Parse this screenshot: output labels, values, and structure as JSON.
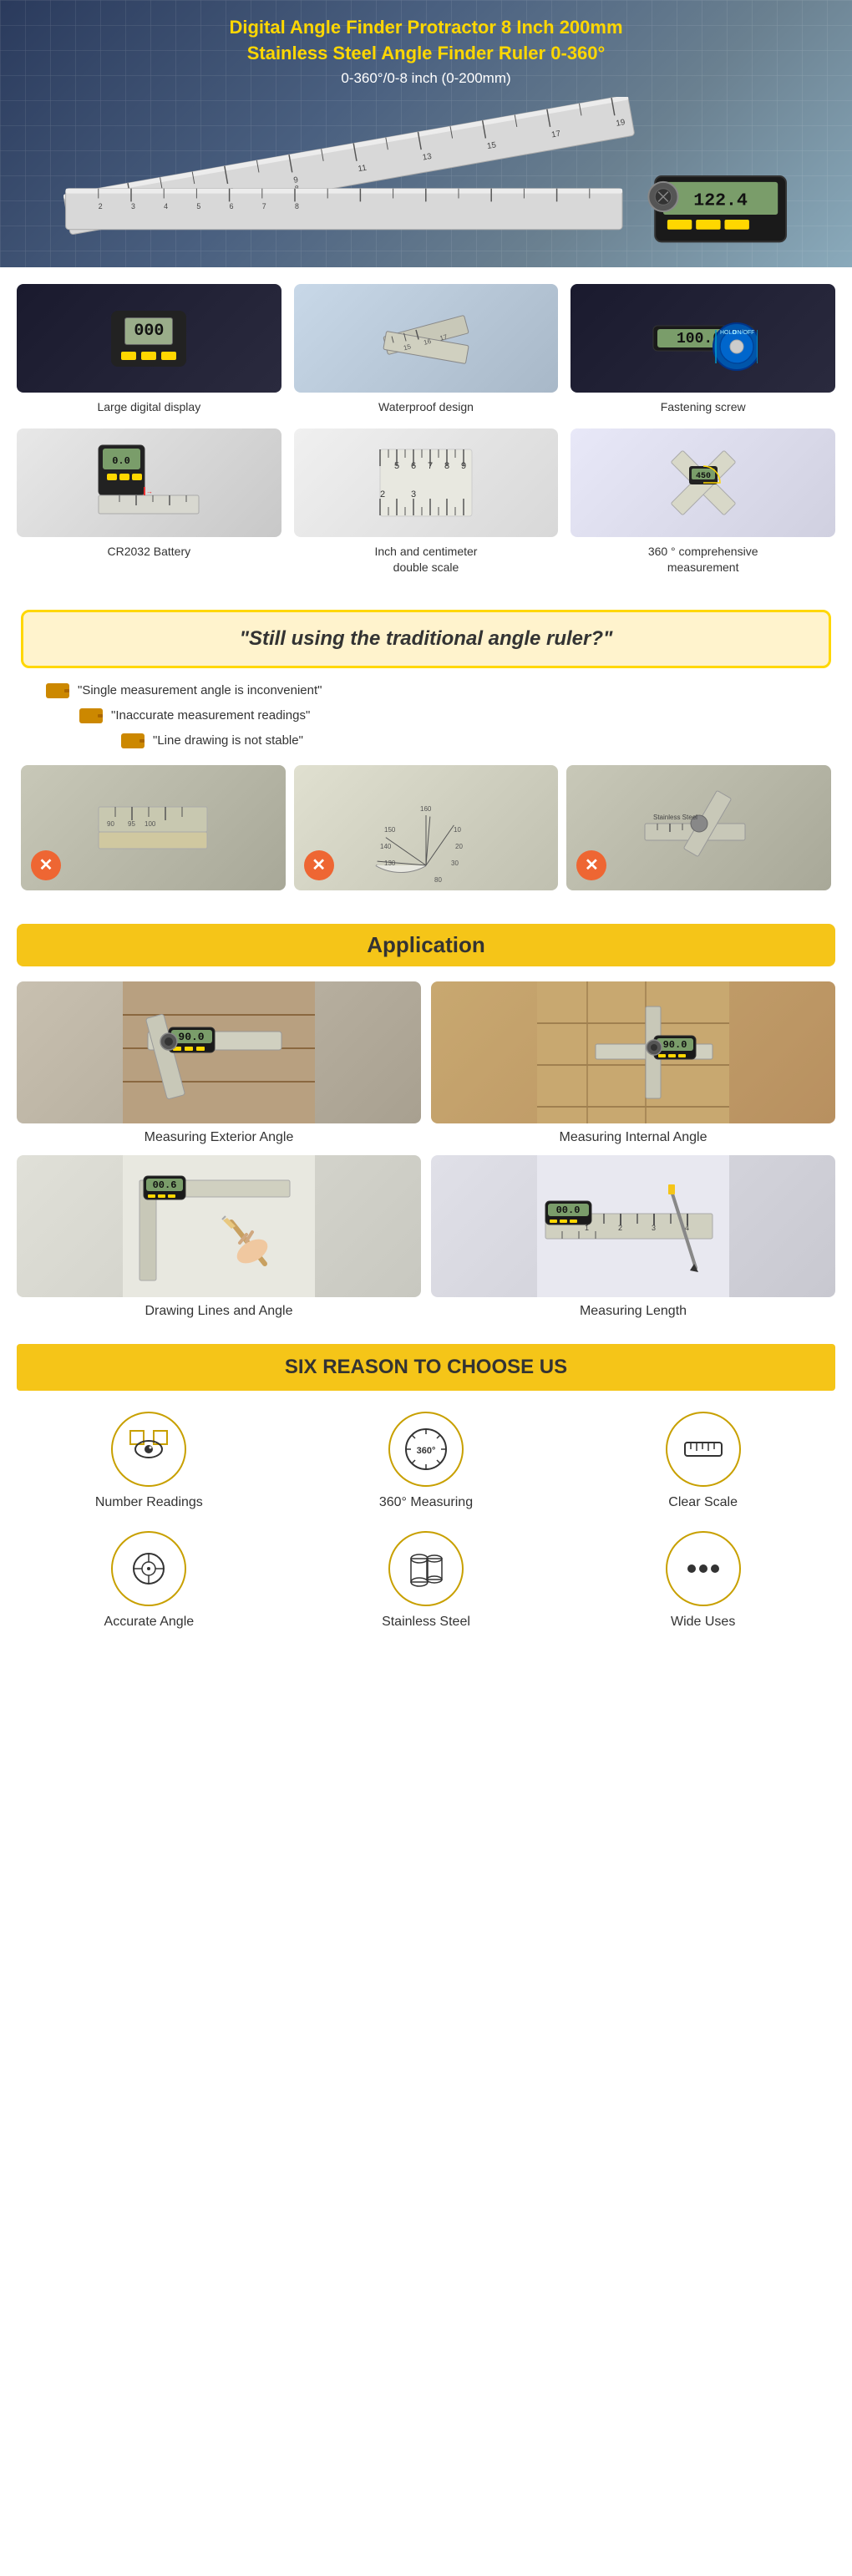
{
  "hero": {
    "title_line1": "Digital Angle Finder Protractor 8 Inch 200mm",
    "title_line2": "Stainless Steel Angle Finder Ruler 0-360°",
    "subtitle": "0-360°/0-8 inch (0-200mm)",
    "display_value": "122.4"
  },
  "features": {
    "items": [
      {
        "id": "digital-display",
        "label": "Large digital display"
      },
      {
        "id": "waterproof",
        "label": "Waterproof design"
      },
      {
        "id": "fastening",
        "label": "Fastening screw"
      },
      {
        "id": "battery",
        "label": "CR2032 Battery"
      },
      {
        "id": "scale",
        "label": "Inch and centimeter\ndouble scale"
      },
      {
        "id": "360",
        "label": "360 ° comprehensive\nmeasurement"
      }
    ]
  },
  "traditional": {
    "banner": "\"Still using the traditional angle ruler?\"",
    "pain_points": [
      "\"Single measurement angle is inconvenient\"",
      "\"Inaccurate measurement readings\"",
      "\"Line drawing is not stable\""
    ]
  },
  "application": {
    "section_title": "Application",
    "items": [
      {
        "id": "exterior",
        "label": "Measuring Exterior Angle"
      },
      {
        "id": "internal",
        "label": "Measuring Internal Angle"
      },
      {
        "id": "drawing",
        "label": "Drawing Lines and Angle"
      },
      {
        "id": "length",
        "label": "Measuring Length"
      }
    ]
  },
  "six_reasons": {
    "section_title": "SIX REASON TO CHOOSE US",
    "items": [
      {
        "id": "number-readings",
        "label": "Number Readings",
        "icon": "eye"
      },
      {
        "id": "360-measuring",
        "label": "360° Measuring",
        "icon": "360"
      },
      {
        "id": "clear-scale",
        "label": "Clear Scale",
        "icon": "ruler"
      },
      {
        "id": "accurate-angle",
        "label": "Accurate Angle",
        "icon": "crosshair"
      },
      {
        "id": "stainless-steel",
        "label": "Stainless Steel",
        "icon": "cylinder"
      },
      {
        "id": "wide-uses",
        "label": "Wide Uses",
        "icon": "dots"
      }
    ]
  }
}
